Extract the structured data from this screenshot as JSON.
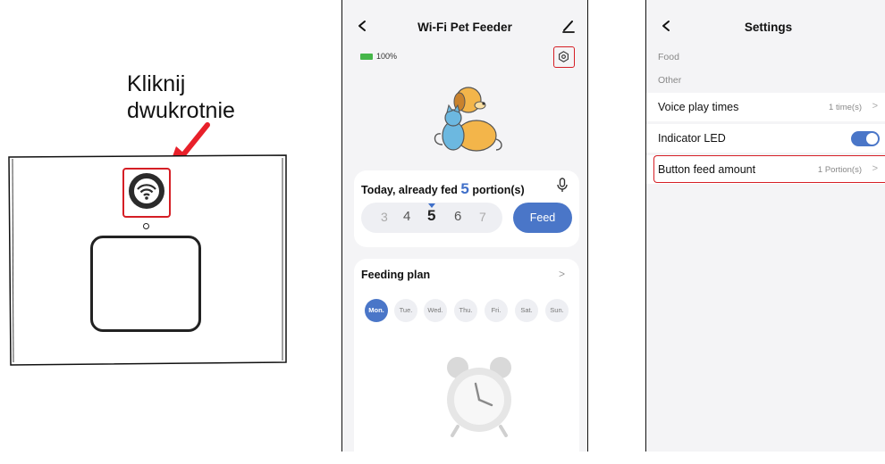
{
  "illustration": {
    "callout_line1": "Kliknij",
    "callout_line2": "dwukrotnie",
    "highlight_color": "#d51e25",
    "arrow_color": "#e8202a",
    "button_icon": "wifi-icon"
  },
  "feeder_screen": {
    "title": "Wi-Fi Pet Feeder",
    "battery_label": "100%",
    "fed_text_prefix": "Today, already fed ",
    "fed_count": "5",
    "fed_text_suffix": " portion(s)",
    "portion_options": [
      "3",
      "4",
      "5",
      "6",
      "7"
    ],
    "selected_portion": "5",
    "feed_button": "Feed",
    "plan_title": "Feeding plan",
    "plan_arrow": ">",
    "days": [
      "Mon.",
      "Tue.",
      "Wed.",
      "Thu.",
      "Fri.",
      "Sat.",
      "Sun."
    ],
    "active_day": "Mon.",
    "accent_color": "#4a76c8"
  },
  "settings_screen": {
    "title": "Settings",
    "section_food": "Food",
    "section_other": "Other",
    "rows": [
      {
        "label": "Voice play times",
        "value": "1 time(s)",
        "arrow": ">"
      },
      {
        "label": "Indicator LED",
        "toggle": true
      },
      {
        "label": "Button feed amount",
        "value": "1 Portion(s)",
        "arrow": ">"
      }
    ]
  }
}
